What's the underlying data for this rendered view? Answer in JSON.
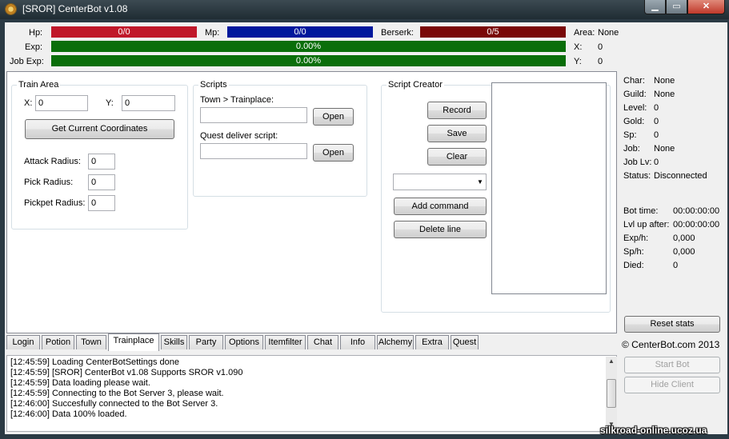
{
  "window": {
    "title": "[SROR] CenterBot v1.08",
    "min": "▁",
    "max": "▭",
    "close": "✕"
  },
  "top": {
    "hp_label": "Hp:",
    "hp_value": "0/0",
    "hp_color": "#c0182a",
    "mp_label": "Mp:",
    "mp_value": "0/0",
    "mp_color": "#00189c",
    "berserk_label": "Berserk:",
    "berserk_value": "0/5",
    "berserk_color": "#7a0808",
    "area_label": "Area:",
    "area_value": "None",
    "exp_label": "Exp:",
    "exp_value": "0.00%",
    "exp_color": "#0a6e0a",
    "x_label": "X:",
    "x_value": "0",
    "jobexp_label": "Job Exp:",
    "jobexp_value": "0.00%",
    "y_label": "Y:",
    "y_value": "0"
  },
  "train_area": {
    "title": "Train Area",
    "x_label": "X:",
    "x_value": "0",
    "y_label": "Y:",
    "y_value": "0",
    "get_coords": "Get Current Coordinates",
    "attack_radius_label": "Attack Radius:",
    "attack_radius": "0",
    "pick_radius_label": "Pick Radius:",
    "pick_radius": "0",
    "pickpet_radius_label": "Pickpet Radius:",
    "pickpet_radius": "0"
  },
  "scripts": {
    "title": "Scripts",
    "town_label": "Town > Trainplace:",
    "town_value": "",
    "open1": "Open",
    "quest_label": "Quest deliver script:",
    "quest_value": "",
    "open2": "Open"
  },
  "creator": {
    "title": "Script Creator",
    "record": "Record",
    "save": "Save",
    "clear": "Clear",
    "command_value": "",
    "add_command": "Add command",
    "delete_line": "Delete line"
  },
  "char_info": [
    {
      "label": "Char:",
      "value": "None"
    },
    {
      "label": "Guild:",
      "value": "None"
    },
    {
      "label": "Level:",
      "value": "0"
    },
    {
      "label": "Gold:",
      "value": "0"
    },
    {
      "label": "Sp:",
      "value": "0"
    },
    {
      "label": "Job:",
      "value": "None"
    },
    {
      "label": "Job Lv:",
      "value": "0"
    },
    {
      "label": "Status:",
      "value": "Disconnected"
    }
  ],
  "stats": [
    {
      "label": "Bot time:",
      "value": "00:00:00:00"
    },
    {
      "label": "Lvl up after:",
      "value": "00:00:00:00"
    },
    {
      "label": "Exp/h:",
      "value": "0,000"
    },
    {
      "label": "Sp/h:",
      "value": "0,000"
    },
    {
      "label": "Died:",
      "value": "0"
    }
  ],
  "reset_stats": "Reset stats",
  "copyright": "© CenterBot.com 2013",
  "start_bot": "Start Bot",
  "hide_client": "Hide Client",
  "tabs": [
    "Login",
    "Potion",
    "Town",
    "Trainplace",
    "Skills",
    "Party",
    "Options",
    "Itemfilter",
    "Chat",
    "Info",
    "Alchemy",
    "Extra",
    "Quest"
  ],
  "log": [
    "[12:45:59] Loading CenterBotSettings done",
    "[12:45:59] [SROR] CenterBot v1.08 Supports SROR v1.090",
    "[12:45:59] Data loading please wait.",
    "[12:45:59] Connecting to the Bot Server 3, please wait.",
    "[12:46:00] Succesfully connected to the Bot Server 3.",
    "[12:46:00] Data 100% loaded."
  ],
  "watermark": "silkroad-online.ucoz.ua"
}
